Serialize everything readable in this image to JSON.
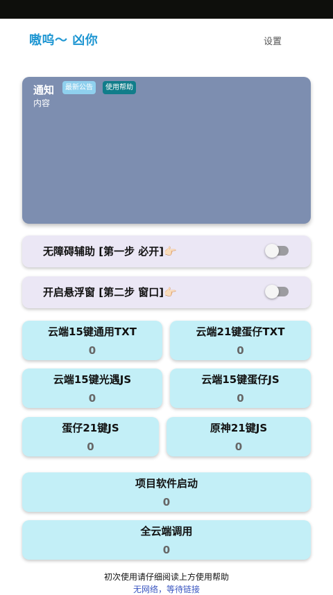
{
  "header": {
    "title": "嗷呜～ 凶你",
    "settings_label": "设置"
  },
  "notice": {
    "title": "通知",
    "body": "内容",
    "chips": {
      "latest": "最新公告",
      "help": "使用帮助"
    }
  },
  "toggles": [
    {
      "label": "无障碍辅助  [第一步 必开]👉🏻",
      "on": false
    },
    {
      "label": "开启悬浮窗  [第二步 窗口]👉🏻",
      "on": false
    }
  ],
  "tiles": [
    {
      "label": "云端15键通用TXT",
      "count": "0"
    },
    {
      "label": "云端21键蛋仔TXT",
      "count": "0"
    },
    {
      "label": "云端15键光遇JS",
      "count": "0"
    },
    {
      "label": "云端15键蛋仔JS",
      "count": "0"
    },
    {
      "label": "蛋仔21键JS",
      "count": "0"
    },
    {
      "label": "原神21键JS",
      "count": "0"
    },
    {
      "label": "项目软件启动",
      "count": "0"
    },
    {
      "label": "全云端调用",
      "count": "0"
    }
  ],
  "footer": {
    "hint": "初次使用请仔细阅读上方使用帮助",
    "status": "无网络，等待链接"
  },
  "colors": {
    "accent": "#1e96d2",
    "notice_bg": "#7d8eb0",
    "tile_bg": "#c3eff7",
    "toggle_bg": "#ebe7f5"
  }
}
